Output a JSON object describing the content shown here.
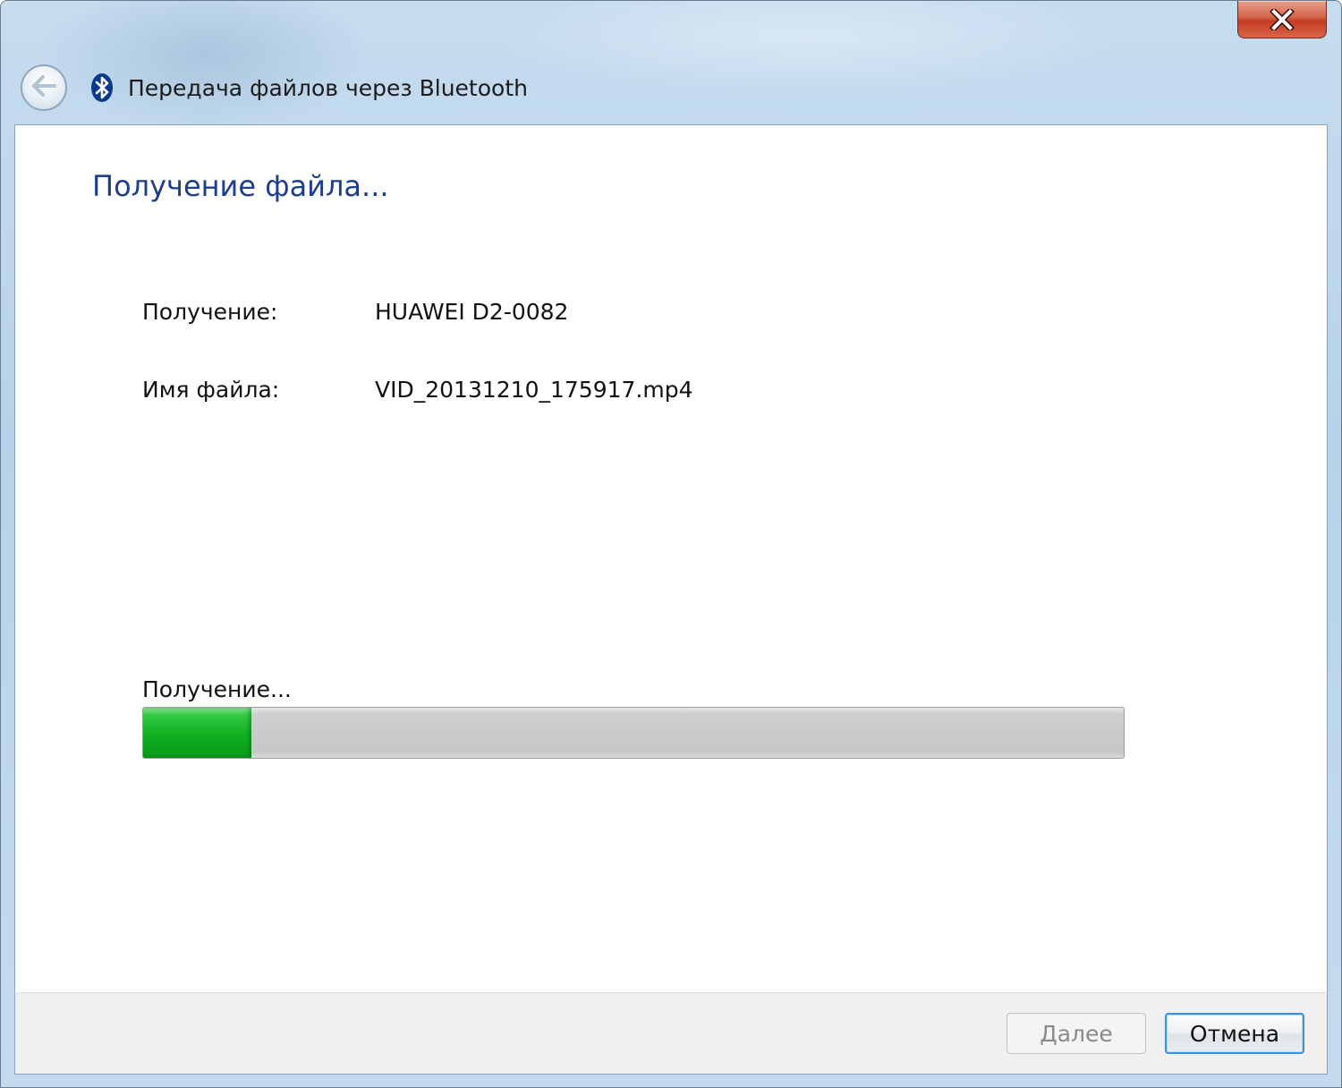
{
  "window": {
    "title": "Передача файлов через Bluetooth",
    "icons": {
      "back": "back-arrow-icon",
      "app": "bluetooth-icon",
      "close": "close-icon"
    }
  },
  "main": {
    "heading": "Получение файла...",
    "fields": [
      {
        "label": "Получение:",
        "value": "HUAWEI D2-0082"
      },
      {
        "label": "Имя файла:",
        "value": "VID_20131210_175917.mp4"
      }
    ],
    "progress": {
      "label": "Получение...",
      "fraction": 0.11
    }
  },
  "footer": {
    "next_label": "Далее",
    "cancel_label": "Отмена"
  },
  "colors": {
    "heading": "#1e3d8c",
    "progress_fill": "#0fb021",
    "progress_track": "#c7c7c7",
    "close_button": "#c23b22",
    "focus_border": "#3d8fd6"
  }
}
